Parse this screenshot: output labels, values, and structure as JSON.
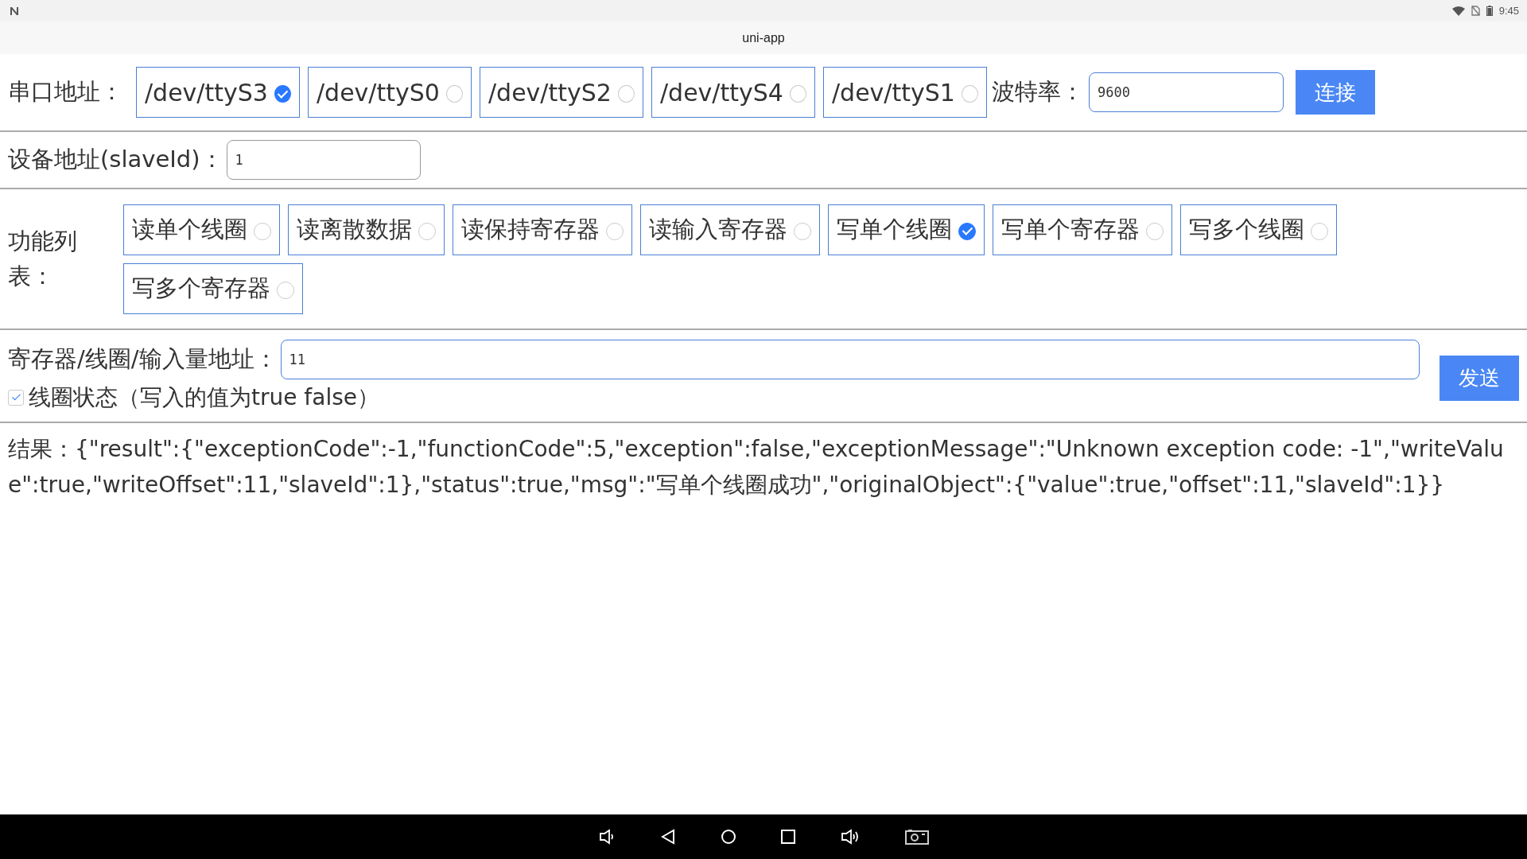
{
  "status_bar": {
    "time": "9:45"
  },
  "window": {
    "title": "uni-app"
  },
  "serial": {
    "label": "串口地址：",
    "ports": [
      {
        "label": "/dev/ttyS3",
        "selected": true
      },
      {
        "label": "/dev/ttyS0",
        "selected": false
      },
      {
        "label": "/dev/ttyS2",
        "selected": false
      },
      {
        "label": "/dev/ttyS4",
        "selected": false
      },
      {
        "label": "/dev/ttyS1",
        "selected": false
      }
    ],
    "baud_label": "波特率：",
    "baud_value": "9600",
    "connect_button": "连接"
  },
  "slave": {
    "label": "设备地址(slaveId)：",
    "value": "1"
  },
  "functions": {
    "label": "功能列表：",
    "items": [
      {
        "label": "读单个线圈",
        "selected": false
      },
      {
        "label": "读离散数据",
        "selected": false
      },
      {
        "label": "读保持寄存器",
        "selected": false
      },
      {
        "label": "读输入寄存器",
        "selected": false
      },
      {
        "label": "写单个线圈",
        "selected": true
      },
      {
        "label": "写单个寄存器",
        "selected": false
      },
      {
        "label": "写多个线圈",
        "selected": false
      },
      {
        "label": "写多个寄存器",
        "selected": false
      }
    ]
  },
  "address": {
    "label": "寄存器/线圈/输入量地址：",
    "value": "11"
  },
  "coil_checkbox": {
    "label": "线圈状态（写入的值为true false）",
    "checked": true
  },
  "send_button": "发送",
  "result": "结果：{\"result\":{\"exceptionCode\":-1,\"functionCode\":5,\"exception\":false,\"exceptionMessage\":\"Unknown exception code: -1\",\"writeValue\":true,\"writeOffset\":11,\"slaveId\":1},\"status\":true,\"msg\":\"写单个线圈成功\",\"originalObject\":{\"value\":true,\"offset\":11,\"slaveId\":1}}"
}
